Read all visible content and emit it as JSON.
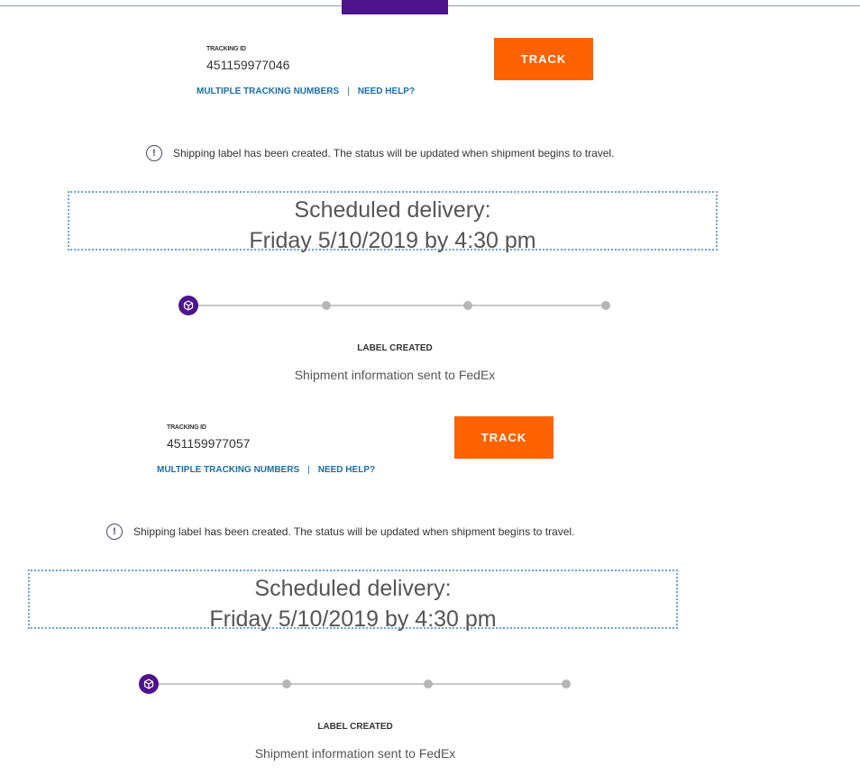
{
  "colors": {
    "brand_purple": "#4d148c",
    "track_orange": "#ff6200",
    "link_blue": "#1a6ea8"
  },
  "shipments": [
    {
      "tracking_label": "TRACKING ID",
      "tracking_id": "451159977046",
      "track_button": "TRACK",
      "links": {
        "multiple": "MULTIPLE TRACKING NUMBERS",
        "separator": "|",
        "help": "NEED HELP?"
      },
      "notice_icon": "exclamation-circle-icon",
      "notice_text": "Shipping label has been created. The status will be updated when shipment begins to travel.",
      "scheduled_heading": "Scheduled delivery:",
      "scheduled_date": "Friday 5/10/2019 by 4:30 pm",
      "progress": {
        "current_step": 1,
        "total_steps": 4,
        "current_icon": "package-icon"
      },
      "status_title": "LABEL CREATED",
      "status_description": "Shipment information sent to FedEx"
    },
    {
      "tracking_label": "TRACKING ID",
      "tracking_id": "451159977057",
      "track_button": "TRACK",
      "links": {
        "multiple": "MULTIPLE TRACKING NUMBERS",
        "separator": "|",
        "help": "NEED HELP?"
      },
      "notice_icon": "exclamation-circle-icon",
      "notice_text": "Shipping label has been created. The status will be updated when shipment begins to travel.",
      "scheduled_heading": "Scheduled delivery:",
      "scheduled_date": "Friday 5/10/2019 by 4:30 pm",
      "progress": {
        "current_step": 1,
        "total_steps": 4,
        "current_icon": "package-icon"
      },
      "status_title": "LABEL CREATED",
      "status_description": "Shipment information sent to FedEx"
    }
  ]
}
